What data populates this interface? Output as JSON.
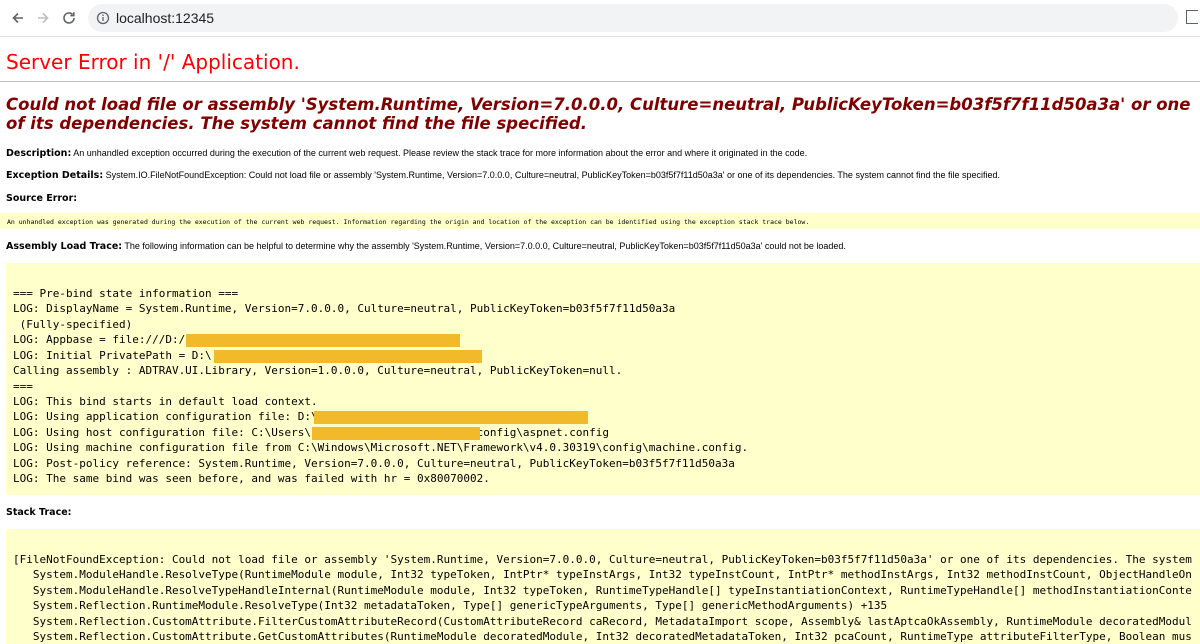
{
  "browser": {
    "url": "localhost:12345",
    "icons": {
      "back": "arrow-left-icon",
      "forward": "arrow-right-icon",
      "reload": "reload-icon",
      "site_info": "site-info-icon"
    }
  },
  "page": {
    "title": "Server Error in '/' Application.",
    "error_message": "Could not load file or assembly 'System.Runtime, Version=7.0.0.0, Culture=neutral, PublicKeyToken=b03f5f7f11d50a3a' or one of its dependencies. The system cannot find the file specified.",
    "description_label": "Description:",
    "description_text": "An unhandled exception occurred during the execution of the current web request. Please review the stack trace for more information about the error and where it originated in the code.",
    "exception_label": "Exception Details:",
    "exception_text": "System.IO.FileNotFoundException: Could not load file or assembly 'System.Runtime, Version=7.0.0.0, Culture=neutral, PublicKeyToken=b03f5f7f11d50a3a' or one of its dependencies. The system cannot find the file specified.",
    "source_label": "Source Error:",
    "source_text": "An unhandled exception was generated during the execution of the current web request. Information regarding the origin and location of the exception can be identified using the exception stack trace below.",
    "assembly_label": "Assembly Load Trace:",
    "assembly_text": "The following information can be helpful to determine why the assembly 'System.Runtime, Version=7.0.0.0, Culture=neutral, PublicKeyToken=b03f5f7f11d50a3a' could not be loaded.",
    "stack_label": "Stack Trace:"
  },
  "assembly_trace": [
    "=== Pre-bind state information ===",
    "LOG: DisplayName = System.Runtime, Version=7.0.0.0, Culture=neutral, PublicKeyToken=b03f5f7f11d50a3a",
    " (Fully-specified)",
    "LOG: Appbase = file:///D:/                         Api/",
    "LOG: Initial PrivatePath = D:\\                          i\\bin",
    "Calling assembly : ADTRAV.UI.Library, Version=1.0.0.0, Culture=neutral, PublicKeyToken=null.",
    "===",
    "LOG: This bind starts in default load context.",
    "LOG: Using application configuration file: D:\\                           \\web.config",
    "LOG: Using host configuration file: C:\\Users\\                    ress\\config\\aspnet.config",
    "LOG: Using machine configuration file from C:\\Windows\\Microsoft.NET\\Framework\\v4.0.30319\\config\\machine.config.",
    "LOG: Post-policy reference: System.Runtime, Version=7.0.0.0, Culture=neutral, PublicKeyToken=b03f5f7f11d50a3a",
    "LOG: The same bind was seen before, and was failed with hr = 0x80070002."
  ],
  "stack_trace": [
    "[FileNotFoundException: Could not load file or assembly 'System.Runtime, Version=7.0.0.0, Culture=neutral, PublicKeyToken=b03f5f7f11d50a3a' or one of its dependencies. The system",
    "   System.ModuleHandle.ResolveType(RuntimeModule module, Int32 typeToken, IntPtr* typeInstArgs, Int32 typeInstCount, IntPtr* methodInstArgs, Int32 methodInstCount, ObjectHandleOn",
    "   System.ModuleHandle.ResolveTypeHandleInternal(RuntimeModule module, Int32 typeToken, RuntimeTypeHandle[] typeInstantiationContext, RuntimeTypeHandle[] methodInstantiationConte",
    "   System.Reflection.RuntimeModule.ResolveType(Int32 metadataToken, Type[] genericTypeArguments, Type[] genericMethodArguments) +135",
    "   System.Reflection.CustomAttribute.FilterCustomAttributeRecord(CustomAttributeRecord caRecord, MetadataImport scope, Assembly& lastAptcaOkAssembly, RuntimeModule decoratedModul",
    "   System.Reflection.CustomAttribute.GetCustomAttributes(RuntimeModule decoratedModule, Int32 decoratedMetadataToken, Int32 pcaCount, RuntimeType attributeFilterType, Boolean mus"
  ],
  "colors": {
    "title": "#ff0000",
    "message": "#800000",
    "highlight": "#ffffcc",
    "redaction": "#f2b92b"
  }
}
